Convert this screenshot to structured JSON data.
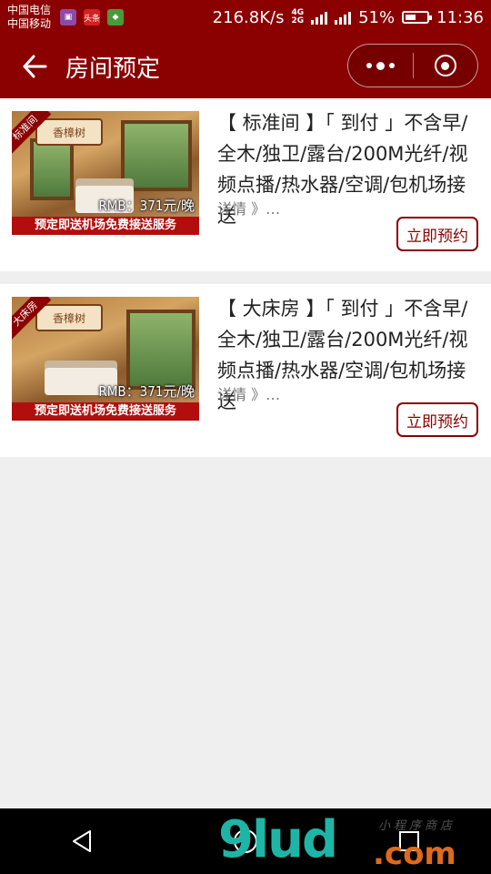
{
  "status_bar": {
    "carrier_1": "中国电信",
    "carrier_2": "中国移动",
    "app_badge": "头条",
    "network_speed": "216.8K/s",
    "network_4g": "4G",
    "network_2g": "2G",
    "battery": "51%",
    "battery_level": 0.51,
    "time": "11:36"
  },
  "nav": {
    "title": "房间预定"
  },
  "rooms": [
    {
      "title": "【 标准间 】「 到付 」不含早/全木/独卫/露台/200M光纤/视频点播/热水器/空调/包机场接送",
      "ribbon": "标准间",
      "logo": "香樟树",
      "price": "RMB：371元/晚",
      "promo": "预定即送机场免费接送服务",
      "detail": "详情 》…",
      "book_label": "立即预约"
    },
    {
      "title": "【 大床房 】「 到付 」不含早/全木/独卫/露台/200M光纤/视频点播/热水器/空调/包机场接送",
      "ribbon": "大床房",
      "logo": "香樟树",
      "price": "RMB：371元/晚",
      "promo": "预定即送机场免费接送服务",
      "detail": "详情 》…",
      "book_label": "立即预约"
    }
  ],
  "watermark": {
    "main": "9lud",
    "suffix": ".com",
    "sub": "小程序商店"
  },
  "colors": {
    "brand": "#8b0000",
    "page_bg": "#efefef"
  }
}
